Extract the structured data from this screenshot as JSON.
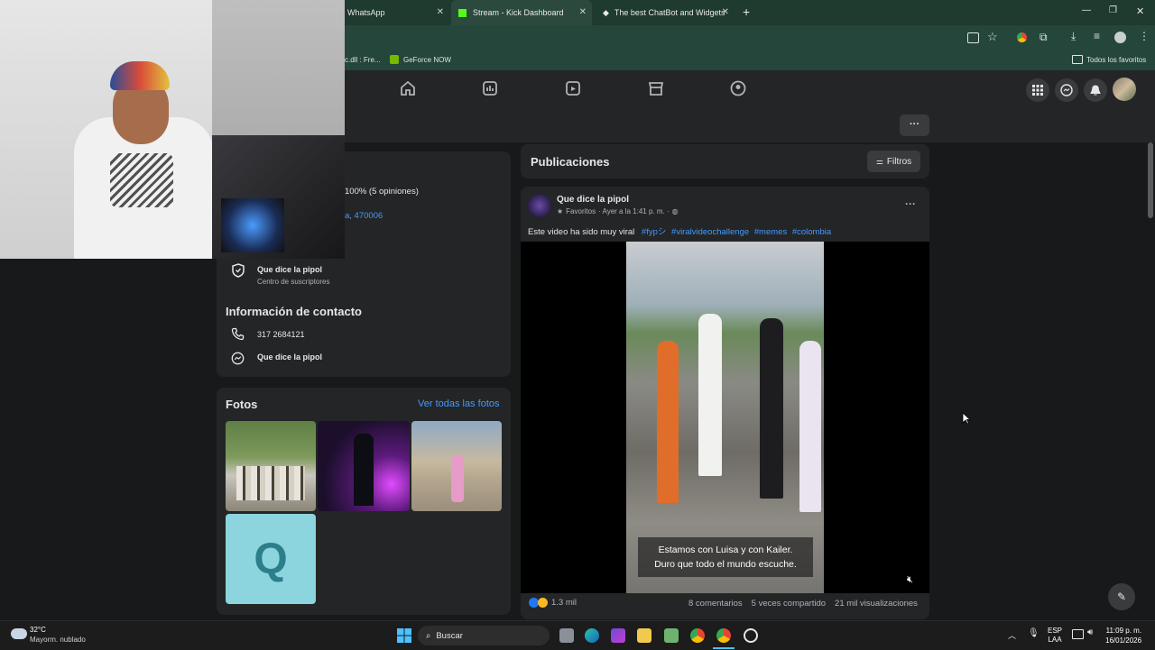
{
  "browser": {
    "tabs": [
      {
        "label": "WhatsApp"
      },
      {
        "label": "Stream - Kick Dashboard"
      },
      {
        "label": "The best ChatBot and Widgets"
      }
    ],
    "bookmarks": [
      {
        "label": "c.dll : Fre..."
      },
      {
        "label": "GeForce NOW"
      }
    ],
    "all_bookmarks": "Todos los favoritos"
  },
  "intro": {
    "rating": "100% (5 opiniones)",
    "address_fragment": "a, 470006"
  },
  "subscription": {
    "name": "Que dice la pipol",
    "sub": "Centro de suscriptores"
  },
  "contact": {
    "title": "Información de contacto",
    "phone": "317 2684121",
    "messenger": "Que dice la pipol"
  },
  "photos": {
    "title": "Fotos",
    "see_all": "Ver todas las fotos",
    "placeholder_letter": "Q"
  },
  "feed": {
    "title": "Publicaciones",
    "filters": "Filtros",
    "more": "···"
  },
  "post": {
    "author": "Que dice la pipol",
    "meta_favorites": "Favoritos",
    "meta_time": "· Ayer a la 1:41 p. m. ·",
    "text": "Este video ha sido muy viral",
    "hashtags": [
      "#fypシ",
      "#viralvideochallenge",
      "#memes",
      "#colombia"
    ],
    "caption_line1": "Estamos con Luisa y con Kailer.",
    "caption_line2": "Duro que todo el mundo escuche.",
    "reactions": "1.3 mil",
    "comments": "8 comentarios",
    "shares": "5 veces compartido",
    "views": "21 mil visualizaciones"
  },
  "taskbar": {
    "weather_temp": "32°C",
    "weather_desc": "Mayorm. nublado",
    "search": "Buscar",
    "lang1": "ESP",
    "lang2": "LAA",
    "time": "11:09 p. m.",
    "date": "16/01/2026"
  },
  "colors": {
    "accent": "#4599ff",
    "panel": "#242526",
    "background": "#18191a",
    "chrome": "#1f3a2e"
  }
}
